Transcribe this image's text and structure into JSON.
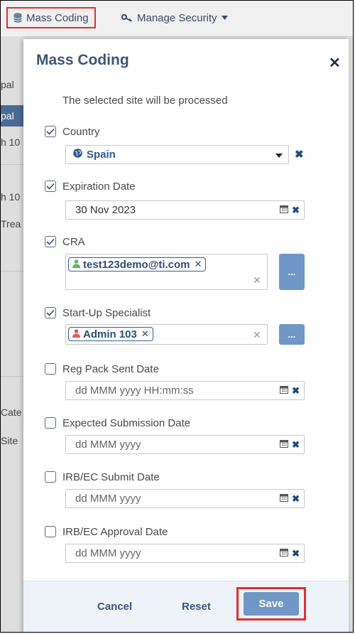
{
  "toolbar": {
    "mass_coding_label": "Mass Coding",
    "manage_security_label": "Manage Security"
  },
  "background": {
    "fragments": [
      "pal",
      "pal",
      "h 10",
      "h 10",
      "Trea",
      "Cate",
      "Site"
    ]
  },
  "modal": {
    "title": "Mass Coding",
    "subtitle": "The selected site will be processed",
    "fields": {
      "country": {
        "label": "Country",
        "checked": true,
        "value": "Spain"
      },
      "expiration_date": {
        "label": "Expiration Date",
        "checked": true,
        "value": "30 Nov 2023"
      },
      "cra": {
        "label": "CRA",
        "checked": true,
        "tag": "test123demo@ti.com",
        "button": "..."
      },
      "startup_specialist": {
        "label": "Start-Up Specialist",
        "checked": true,
        "tag": "Admin 103",
        "button": "..."
      },
      "reg_pack_sent_date": {
        "label": "Reg Pack Sent Date",
        "checked": false,
        "placeholder": "dd MMM yyyy HH:mm:ss"
      },
      "expected_submission_date": {
        "label": "Expected Submission Date",
        "checked": false,
        "placeholder": "dd MMM yyyy"
      },
      "irb_submit_date": {
        "label": "IRB/EC Submit Date",
        "checked": false,
        "placeholder": "dd MMM yyyy"
      },
      "irb_approval_date": {
        "label": "IRB/EC Approval Date",
        "checked": false,
        "placeholder": "dd MMM yyyy"
      }
    },
    "footer": {
      "cancel_label": "Cancel",
      "reset_label": "Reset",
      "save_label": "Save"
    }
  },
  "icons": {
    "database": "database-icon",
    "key": "key-icon",
    "globe": "globe-icon",
    "user": "user-icon",
    "calendar": "calendar-icon",
    "close": "close-icon"
  },
  "colors": {
    "accent": "#3a5577",
    "primary_button": "#7097c6",
    "highlight_red": "#e03030",
    "user_green": "#5cb85c",
    "user_red": "#e05a5a"
  }
}
